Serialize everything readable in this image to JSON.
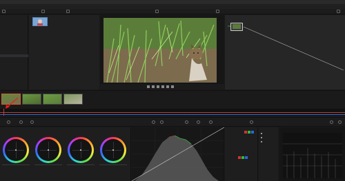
{
  "titlebar": {
    "title": "",
    "minimize_glyph": "",
    "maximize_glyph": "",
    "close_glyph": ""
  },
  "menu": [],
  "left_panel": {
    "items": [
      {
        "label": ""
      },
      {
        "label": ""
      },
      {
        "label": ""
      },
      {
        "label": ""
      },
      {
        "label": ""
      },
      {
        "label": ""
      },
      {
        "label": ""
      },
      {
        "label": ""
      },
      {
        "label": ""
      },
      {
        "label": ""
      },
      {
        "label": "",
        "active": true
      },
      {
        "label": ""
      },
      {
        "label": ""
      }
    ]
  },
  "viewer": {
    "timecode": "",
    "image_subject": "cat-in-grass"
  },
  "clips": [
    {
      "label": "",
      "selected": true
    },
    {
      "label": "",
      "selected": false
    },
    {
      "label": "",
      "selected": false
    },
    {
      "label": "",
      "selected": false
    }
  ],
  "wheels": [
    {
      "title": "",
      "values": ""
    },
    {
      "title": "",
      "values": ""
    },
    {
      "title": "",
      "values": ""
    },
    {
      "title": "",
      "values": ""
    }
  ],
  "rgb_panel": {
    "rows": [
      {
        "label": ""
      },
      {
        "label": ""
      },
      {
        "label": ""
      },
      {
        "label": ""
      },
      {
        "label": ""
      }
    ],
    "swatches": [
      "#d93030",
      "#2fbd38",
      "#2a67e0"
    ]
  },
  "colors": {
    "accent_red": "#d33333",
    "accent_blue": "#2b6fd3",
    "selection_orange": "#e05a2b"
  },
  "icons": {
    "toolbar": [
      "media-icon",
      "cut-icon",
      "edit-icon",
      "fusion-icon",
      "color-icon",
      "fairlight-icon",
      "deliver-icon"
    ],
    "tools": [
      "wheels-icon",
      "curves-icon",
      "qualifier-icon",
      "window-icon",
      "tracker-icon",
      "blur-icon",
      "key-icon",
      "sizing-icon",
      "3d-icon"
    ]
  }
}
